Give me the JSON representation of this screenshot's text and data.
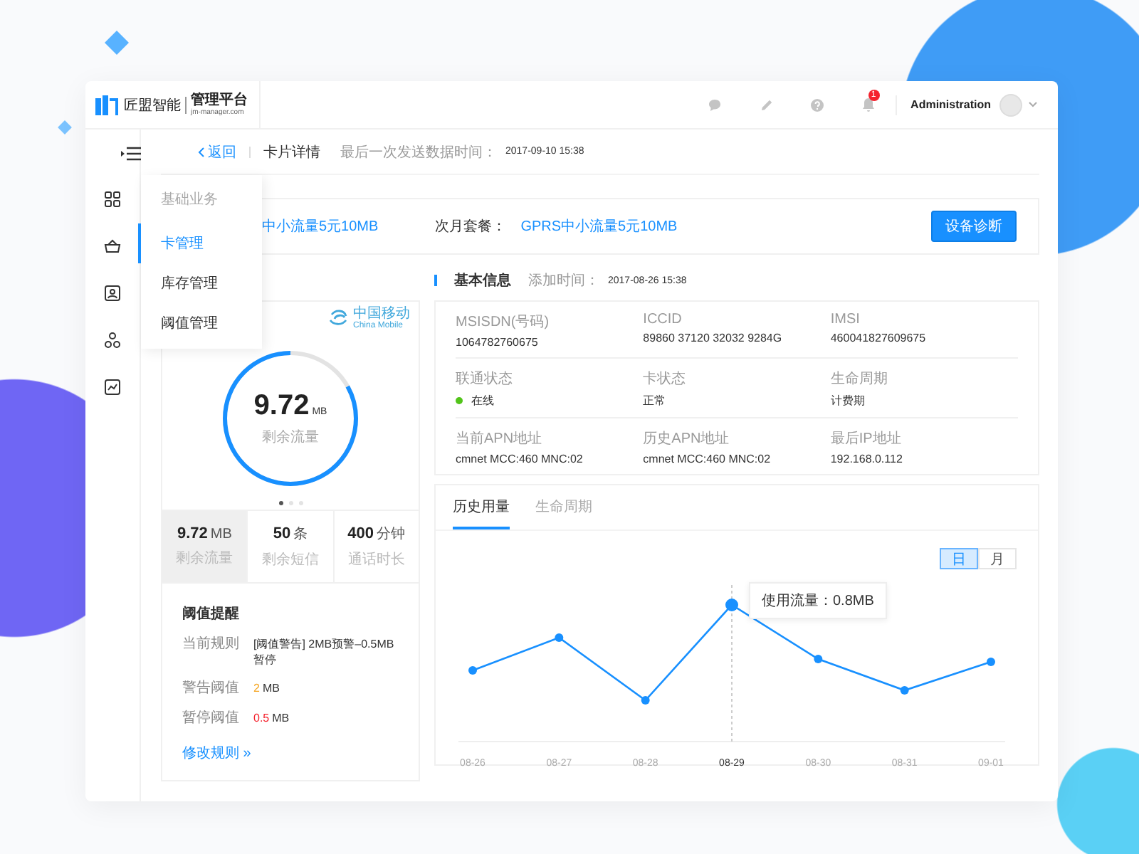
{
  "brand": {
    "name": "匠盟智能",
    "product": "管理平台",
    "domain": "jm-manager.com"
  },
  "header": {
    "notification_count": "1",
    "user": "Administration"
  },
  "breadcrumb": {
    "back": "返回",
    "title": "卡片详情",
    "last_sent_label": "最后一次发送数据时间：",
    "last_sent": "2017-09-10 15:38"
  },
  "flyout_menu": {
    "heading": "基础业务",
    "items": [
      {
        "label": "卡管理",
        "selected": true
      },
      {
        "label": "库存管理",
        "selected": false
      },
      {
        "label": "阈值管理",
        "selected": false
      }
    ]
  },
  "plan": {
    "current_plan_fragment": "中小流量5元10MB",
    "next_label": "次月套餐：",
    "next_plan": "GPRS中小流量5元10MB",
    "button": "设备诊断"
  },
  "usage_card": {
    "carrier": "中国移动",
    "carrier_en": "China Mobile",
    "value": "9.72",
    "unit": "MB",
    "caption": "剩余流量",
    "level": 0.83,
    "pager": [
      {
        "selected": true
      },
      {
        "selected": false
      },
      {
        "selected": false
      }
    ],
    "stats": [
      {
        "value": "9.72",
        "unit": "MB",
        "label": "剩余流量",
        "selected": true
      },
      {
        "value": "50",
        "unit": "条",
        "label": "剩余短信",
        "selected": false
      },
      {
        "value": "400",
        "unit": "分钟",
        "label": "通话时长",
        "selected": false
      }
    ]
  },
  "threshold": {
    "title": "阈值提醒",
    "rows": [
      {
        "label": "当前规则",
        "value": "[阈值警告] 2MB预警–0.5MB暂停"
      },
      {
        "label": "警告阈值",
        "value": "2",
        "unit": "MB",
        "color": "#f5a623"
      },
      {
        "label": "暂停阈值",
        "value": "0.5",
        "unit": "MB",
        "color": "#f5222d"
      }
    ],
    "link": "修改规则 »"
  },
  "basic_info": {
    "title": "基本信息",
    "added_label": "添加时间：",
    "added": "2017-08-26 15:38",
    "rows": [
      [
        {
          "label": "MSISDN(号码)",
          "value": "1064782760675"
        },
        {
          "label": "ICCID",
          "value": "89860 37120 32032 9284G"
        },
        {
          "label": "IMSI",
          "value": "460041827609675"
        }
      ],
      [
        {
          "label": "联通状态",
          "value": "在线",
          "color": "#52c41a"
        },
        {
          "label": "卡状态",
          "value": "正常"
        },
        {
          "label": "生命周期",
          "value": "计费期"
        }
      ],
      [
        {
          "label": "当前APN地址",
          "value": "cmnet MCC:460 MNC:02"
        },
        {
          "label": "历史APN地址",
          "value": "cmnet MCC:460 MNC:02"
        },
        {
          "label": "最后IP地址",
          "value": "192.168.0.112"
        }
      ]
    ]
  },
  "history": {
    "tabs": [
      {
        "label": "历史用量",
        "selected": true
      },
      {
        "label": "生命周期",
        "selected": false
      }
    ],
    "toggle": [
      {
        "label": "日",
        "selected": true
      },
      {
        "label": "月",
        "selected": false
      }
    ],
    "tooltip": "使用流量：0.8MB",
    "x_labels": [
      {
        "label": "08-26",
        "selected": false
      },
      {
        "label": "08-27",
        "selected": false
      },
      {
        "label": "08-28",
        "selected": false
      },
      {
        "label": "08-29",
        "selected": true
      },
      {
        "label": "08-30",
        "selected": false
      },
      {
        "label": "08-31",
        "selected": false
      },
      {
        "label": "09-01",
        "selected": false
      }
    ]
  }
}
